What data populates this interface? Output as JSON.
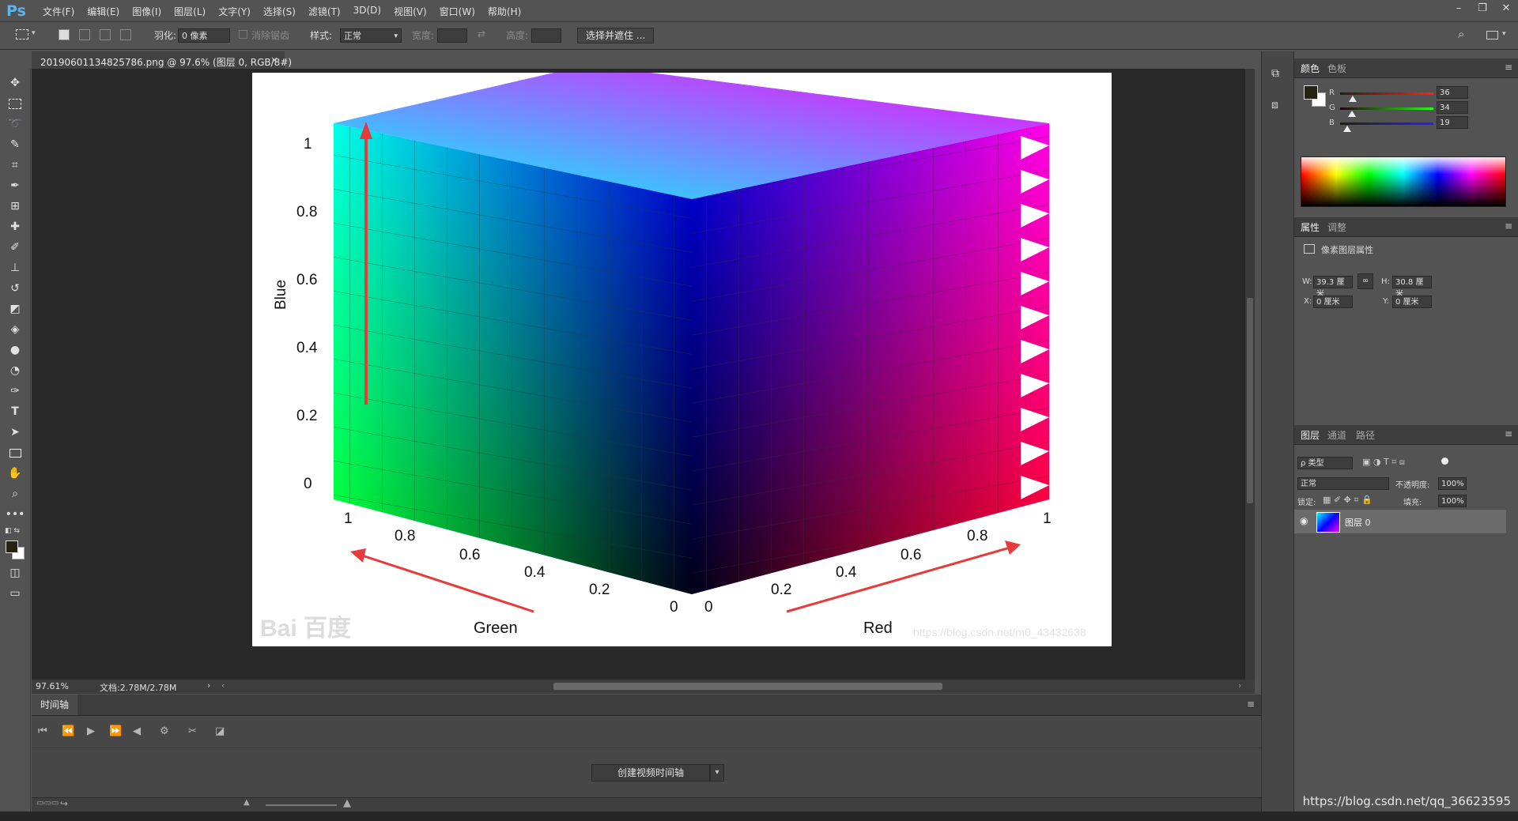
{
  "app": {
    "logo": "Ps",
    "menu": [
      "文件(F)",
      "编辑(E)",
      "图像(I)",
      "图层(L)",
      "文字(Y)",
      "选择(S)",
      "滤镜(T)",
      "3D(D)",
      "视图(V)",
      "窗口(W)",
      "帮助(H)"
    ],
    "window_controls": [
      "–",
      "❐",
      "✕"
    ]
  },
  "options": {
    "feather_label": "羽化:",
    "feather_value": "0 像素",
    "antialias_label": "消除锯齿",
    "style_label": "样式:",
    "style_value": "正常",
    "width_label": "宽度:",
    "height_label": "高度:",
    "select_mask_button": "选择并遮住 ..."
  },
  "document": {
    "tab_title": "20190601134825786.png @ 97.6% (图层 0, RGB/8#)",
    "close_glyph": "×",
    "zoom": "97.61%",
    "doc_size": "文档:2.78M/2.78M"
  },
  "image": {
    "axis_blue": "Blue",
    "axis_green": "Green",
    "axis_red": "Red",
    "blue_ticks": [
      "1",
      "0.8",
      "0.6",
      "0.4",
      "0.2",
      "0"
    ],
    "green_ticks": [
      "1",
      "0.8",
      "0.6",
      "0.4",
      "0.2",
      "0"
    ],
    "red_ticks": [
      "0",
      "0.2",
      "0.4",
      "0.6",
      "0.8",
      "1"
    ],
    "watermark_baidu": "Bai 百度",
    "watermark_url": "https://blog.csdn.net/m0_43432638"
  },
  "timeline": {
    "tab": "时间轴",
    "create_button": "创建视频时间轴"
  },
  "color_panel": {
    "tabs": [
      "颜色",
      "色板"
    ],
    "r_label": "R",
    "r_value": "36",
    "g_label": "G",
    "g_value": "34",
    "b_label": "B",
    "b_value": "19",
    "foreground": "#242213"
  },
  "properties_panel": {
    "tabs": [
      "属性",
      "调整"
    ],
    "title": "像素图层属性",
    "w_label": "W:",
    "w_value": "39.3 厘米",
    "h_label": "H:",
    "h_value": "30.8 厘米",
    "x_label": "X:",
    "x_value": "0 厘米",
    "y_label": "Y:",
    "y_value": "0 厘米"
  },
  "layers_panel": {
    "tabs": [
      "图层",
      "通道",
      "路径"
    ],
    "filter_kind": "ρ 类型",
    "blend_mode": "正常",
    "opacity_label": "不透明度:",
    "opacity_value": "100%",
    "lock_label": "锁定:",
    "fill_label": "填充:",
    "fill_value": "100%",
    "layer_name": "图层 0"
  },
  "footer_watermark": "https://blog.csdn.net/qq_36623595"
}
